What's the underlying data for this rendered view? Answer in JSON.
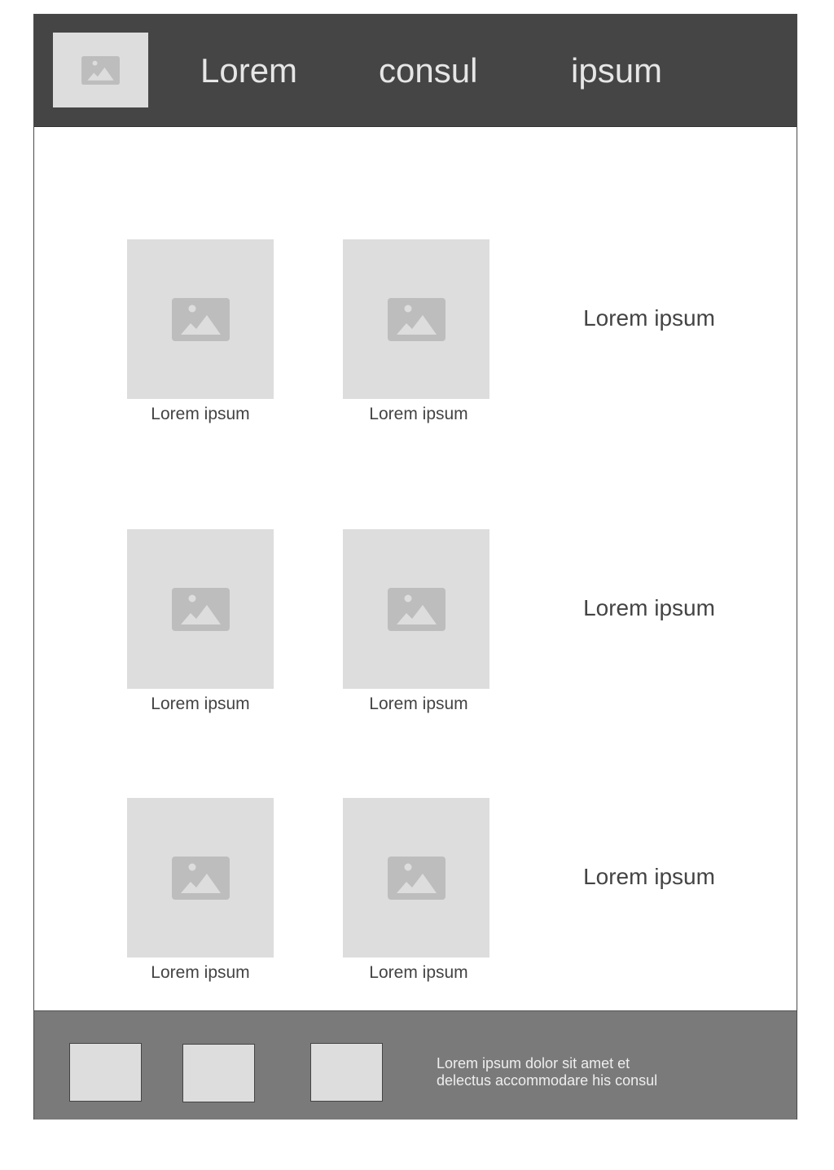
{
  "header": {
    "logo_icon": "image-icon",
    "nav": [
      "Lorem",
      "consul",
      "ipsum"
    ]
  },
  "grid": {
    "rows": [
      {
        "items": [
          {
            "icon": "image-icon",
            "caption": "Lorem ipsum"
          },
          {
            "icon": "image-icon",
            "caption": "Lorem ipsum"
          }
        ],
        "label": "Lorem ipsum"
      },
      {
        "items": [
          {
            "icon": "image-icon",
            "caption": "Lorem ipsum"
          },
          {
            "icon": "image-icon",
            "caption": "Lorem ipsum"
          }
        ],
        "label": "Lorem ipsum"
      },
      {
        "items": [
          {
            "icon": "image-icon",
            "caption": "Lorem ipsum"
          },
          {
            "icon": "image-icon",
            "caption": "Lorem ipsum"
          }
        ],
        "label": "Lorem ipsum"
      }
    ]
  },
  "footer": {
    "text_line1": "Lorem ipsum dolor sit amet et",
    "text_line2": "delectus accommodare his consul"
  },
  "colors": {
    "header_bg": "#454545",
    "footer_bg": "#7a7a7a",
    "placeholder_bg": "#dddddd",
    "placeholder_icon": "#bdbdbd"
  }
}
